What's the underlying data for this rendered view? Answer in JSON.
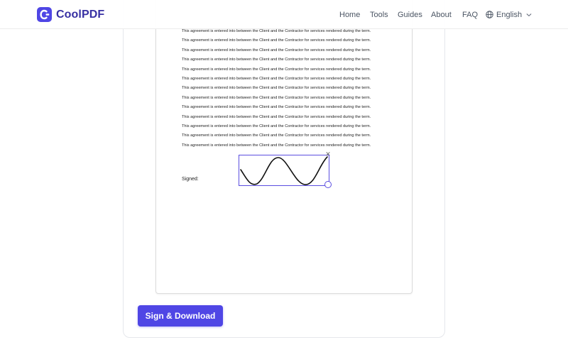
{
  "brand": {
    "name": "CoolPDF",
    "accent": "#4f46e5"
  },
  "nav": {
    "items": [
      {
        "label": "Home"
      },
      {
        "label": "Tools"
      },
      {
        "label": "Guides"
      },
      {
        "label": "About"
      },
      {
        "label": "FAQ"
      }
    ],
    "language": "English"
  },
  "document": {
    "lines": [
      "This agreement is entered into between the Client and the Contractor for services rendered during the term.",
      "This agreement is entered into between the Client and the Contractor for services rendered during the term.",
      "This agreement is entered into between the Client and the Contractor for services rendered during the term.",
      "This agreement is entered into between the Client and the Contractor for services rendered during the term.",
      "This agreement is entered into between the Client and the Contractor for services rendered during the term.",
      "This agreement is entered into between the Client and the Contractor for services rendered during the term.",
      "This agreement is entered into between the Client and the Contractor for services rendered during the term.",
      "This agreement is entered into between the Client and the Contractor for services rendered during the term.",
      "This agreement is entered into between the Client and the Contractor for services rendered during the term.",
      "This agreement is entered into between the Client and the Contractor for services rendered during the term.",
      "This agreement is entered into between the Client and the Contractor for services rendered during the term.",
      "This agreement is entered into between the Client and the Contractor for services rendered during the term.",
      "This agreement is entered into between the Client and the Contractor for services rendered during the term."
    ],
    "signed_label": "Signed:"
  },
  "signature": {
    "close_glyph": "✕",
    "box_color": "#5b4ee0"
  },
  "actions": {
    "sign_download": "Sign & Download"
  }
}
